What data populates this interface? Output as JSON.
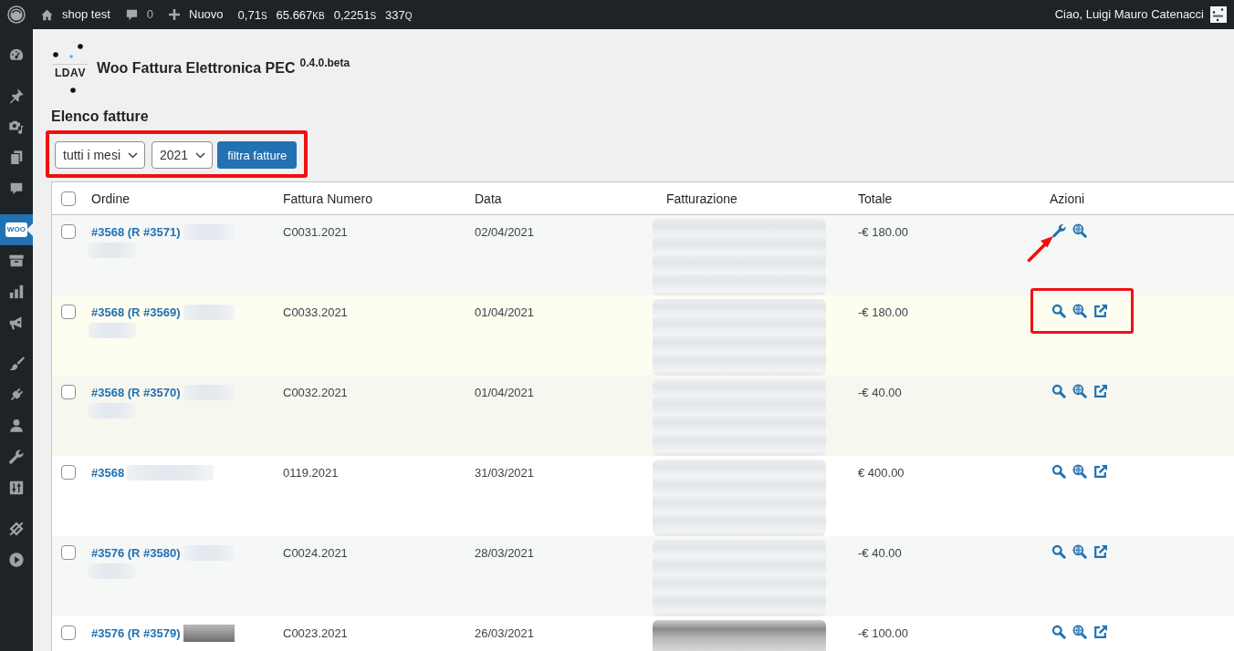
{
  "admin_bar": {
    "site_name": "shop test",
    "comments_count": "0",
    "new_label": "Nuovo",
    "stats": [
      {
        "value": "0,71",
        "unit": "S"
      },
      {
        "value": "65.667",
        "unit": "KB"
      },
      {
        "value": "0,2251",
        "unit": "S"
      },
      {
        "value": "337",
        "unit": "Q"
      }
    ],
    "greeting": "Ciao, Luigi Mauro Catenacci"
  },
  "sidebar": {
    "groups": [
      [
        {
          "selected": false
        }
      ],
      [
        {
          "selected": false
        },
        {
          "selected": false
        },
        {
          "selected": false
        },
        {
          "selected": false
        }
      ],
      [
        {
          "selected": true,
          "logo_text": "WOO"
        },
        {
          "selected": false
        },
        {
          "selected": false
        },
        {
          "selected": false
        }
      ],
      [
        {
          "selected": false
        },
        {
          "selected": false
        },
        {
          "selected": false
        },
        {
          "selected": false
        },
        {
          "selected": false
        }
      ],
      [
        {
          "selected": false
        },
        {
          "selected": false
        }
      ]
    ]
  },
  "plugin": {
    "logo_text": "LDAV",
    "title": "Woo Fattura Elettronica PEC",
    "version": "0.4.0.beta"
  },
  "page_title": "Elenco fatture",
  "filters": {
    "highlighted": true,
    "month_select": "tutti i mesi",
    "year_select": "2021",
    "submit_button": "filtra fatture"
  },
  "table": {
    "select_all_checked": false,
    "columns": [
      "Ordine",
      "Fattura Numero",
      "Data",
      "Fatturazione",
      "Totale",
      "Azioni"
    ],
    "rows": [
      {
        "checked": false,
        "color": "#f6f7f7",
        "order": "#3568 (R #3571)",
        "name_blurred": true,
        "name_blur_two_lines": true,
        "invoice_number": "C0031.2021",
        "date": "02/04/2021",
        "billing_blurred": true,
        "blur_dark": false,
        "total": "-€ 180.00",
        "actions": [
          {
            "kind": "wrench"
          },
          {
            "kind": "globe-search"
          }
        ],
        "actions_highlighted": false,
        "pointer_arrow": true
      },
      {
        "checked": false,
        "color": "#fdfdf0",
        "order": "#3568 (R #3569)",
        "name_blurred": true,
        "name_blur_two_lines": true,
        "invoice_number": "C0033.2021",
        "date": "01/04/2021",
        "billing_blurred": true,
        "blur_dark": false,
        "total": "-€ 180.00",
        "actions": [
          {
            "kind": "search"
          },
          {
            "kind": "globe-search"
          },
          {
            "kind": "external-link"
          }
        ],
        "actions_highlighted": true,
        "pointer_arrow": false
      },
      {
        "checked": false,
        "color": "#f7f7ef",
        "order": "#3568 (R #3570)",
        "name_blurred": true,
        "name_blur_two_lines": true,
        "invoice_number": "C0032.2021",
        "date": "01/04/2021",
        "billing_blurred": true,
        "blur_dark": false,
        "total": "-€ 40.00",
        "actions": [
          {
            "kind": "search"
          },
          {
            "kind": "globe-search"
          },
          {
            "kind": "external-link"
          }
        ],
        "actions_highlighted": false,
        "pointer_arrow": false
      },
      {
        "checked": false,
        "color": "#ffffff",
        "order": "#3568",
        "name_blurred": true,
        "name_blur_two_lines": false,
        "invoice_number": "0119.2021",
        "date": "31/03/2021",
        "billing_blurred": true,
        "blur_dark": false,
        "total": "€ 400.00",
        "actions": [
          {
            "kind": "search"
          },
          {
            "kind": "globe-search"
          },
          {
            "kind": "external-link"
          }
        ],
        "actions_highlighted": false,
        "pointer_arrow": false
      },
      {
        "checked": false,
        "color": "#f6f7f7",
        "order": "#3576 (R #3580)",
        "name_blurred": true,
        "name_blur_two_lines": true,
        "invoice_number": "C0024.2021",
        "date": "28/03/2021",
        "billing_blurred": true,
        "blur_dark": false,
        "total": "-€ 40.00",
        "actions": [
          {
            "kind": "search"
          },
          {
            "kind": "globe-search"
          },
          {
            "kind": "external-link"
          }
        ],
        "actions_highlighted": false,
        "pointer_arrow": false
      },
      {
        "checked": false,
        "color": "#ffffff",
        "order": "#3576 (R #3579)",
        "name_blurred": true,
        "name_blur_two_lines": false,
        "invoice_number": "C0023.2021",
        "date": "26/03/2021",
        "billing_blurred": true,
        "blur_dark": true,
        "total": "-€ 100.00",
        "actions": [
          {
            "kind": "search"
          },
          {
            "kind": "globe-search"
          },
          {
            "kind": "external-link"
          }
        ],
        "actions_highlighted": false,
        "pointer_arrow": false
      }
    ]
  }
}
